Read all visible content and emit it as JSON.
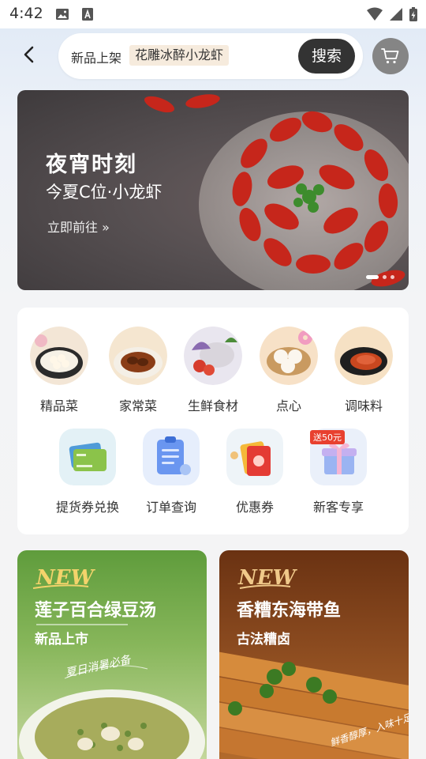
{
  "status_bar": {
    "time": "4:42",
    "icons": [
      "image-icon",
      "keyboard-a-icon",
      "wifi-icon",
      "signal-icon",
      "battery-charging-icon"
    ]
  },
  "header": {
    "search_prefix": "新品上架",
    "search_tag": "花雕冰醉小龙虾",
    "search_button": "搜索"
  },
  "banner": {
    "title": "夜宵时刻",
    "subtitle": "今夏C位·小龙虾",
    "link": "立即前往 »",
    "page_count": 3,
    "active_page": 1
  },
  "categories": [
    {
      "label": "精品菜",
      "icon": "premium-dish-icon"
    },
    {
      "label": "家常菜",
      "icon": "home-dish-icon"
    },
    {
      "label": "生鲜食材",
      "icon": "fresh-ingredients-icon"
    },
    {
      "label": "点心",
      "icon": "dim-sum-icon"
    },
    {
      "label": "调味料",
      "icon": "seasoning-icon"
    }
  ],
  "services": [
    {
      "label": "提货券兑换",
      "icon": "voucher-card-icon"
    },
    {
      "label": "订单查询",
      "icon": "order-clipboard-icon"
    },
    {
      "label": "优惠券",
      "icon": "coupon-icon"
    },
    {
      "label": "新客专享",
      "icon": "gift-box-icon",
      "badge": "送50元"
    }
  ],
  "promos": [
    {
      "badge": "NEW",
      "title": "莲子百合绿豆汤",
      "subtitle": "新品上市",
      "tagline": "夏日消暑必备"
    },
    {
      "badge": "NEW",
      "title": "香糟东海带鱼",
      "subtitle": "古法糟卤",
      "tagline": "鲜香醇厚，入味十足"
    }
  ],
  "colors": {
    "search_button": "#333333",
    "search_tag_bg": "#f6ebdd",
    "new_badge_green": "#f3d36b",
    "new_badge_brown": "#f0c98a"
  }
}
